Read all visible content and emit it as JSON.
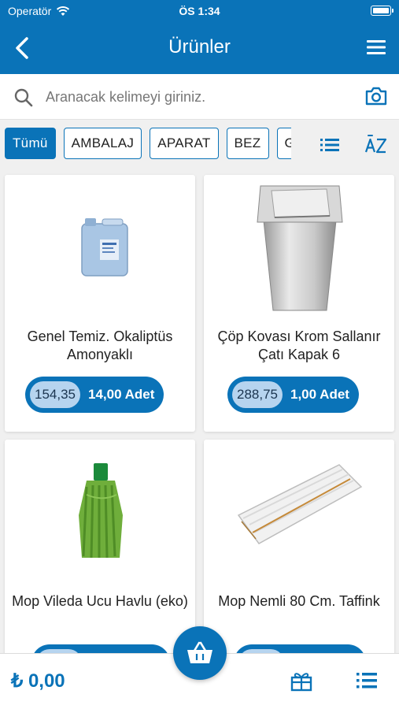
{
  "status": {
    "carrier": "Operatör",
    "time": "ÖS 1:34"
  },
  "navbar": {
    "title": "Ürünler"
  },
  "search": {
    "placeholder": "Aranacak kelimeyi giriniz."
  },
  "categories": [
    "Tümü",
    "AMBALAJ",
    "APARAT",
    "BEZ",
    "G"
  ],
  "active_category": "Tümü",
  "products": [
    {
      "name": "Genel Temiz. Okaliptüs Amonyaklı",
      "price": "154,35",
      "quantity": "14,00 Adet"
    },
    {
      "name": "Çöp Kovası Krom Sallanır Çatı Kapak  6",
      "price": "288,75",
      "quantity": "1,00 Adet"
    },
    {
      "name": "Mop Vileda Ucu Havlu (eko)",
      "price": "",
      "quantity": ""
    },
    {
      "name": "Mop Nemli 80 Cm. Taffink",
      "price": "",
      "quantity": ""
    }
  ],
  "cart": {
    "total": "₺ 0,00"
  },
  "colors": {
    "primary": "#0a73b8",
    "price_badge": "#b6d4ef",
    "background": "#f0f0f0"
  },
  "icons": [
    "wifi-icon",
    "battery-icon",
    "back-arrow-icon",
    "hamburger-menu-icon",
    "search-icon",
    "camera-icon",
    "list-view-icon",
    "sort-az-icon",
    "basket-icon",
    "gift-icon",
    "list-icon"
  ]
}
